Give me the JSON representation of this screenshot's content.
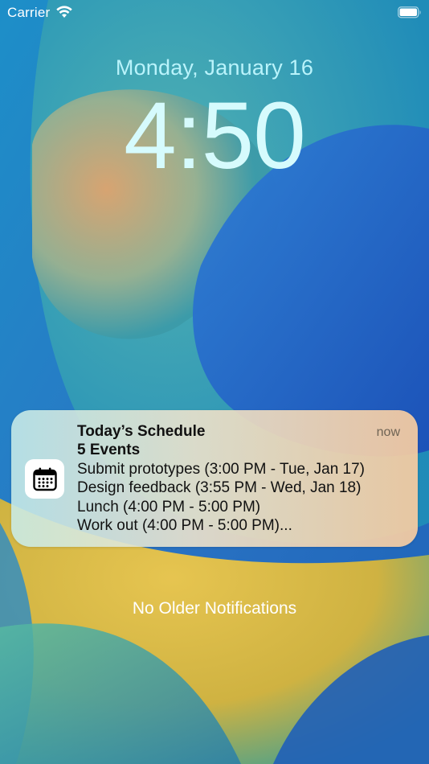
{
  "status_bar": {
    "carrier": "Carrier",
    "wifi_icon": "wifi-icon",
    "battery_icon": "battery-icon"
  },
  "lock_screen": {
    "date": "Monday, January 16",
    "time": "4:50"
  },
  "notification": {
    "app_icon": "calendar-icon",
    "title": "Today’s Schedule",
    "timestamp": "now",
    "subtitle": "5 Events",
    "lines": [
      "Submit prototypes (3:00 PM - Tue, Jan 17)",
      "Design feedback (3:55 PM - Wed, Jan 18)",
      "Lunch (4:00 PM - 5:00 PM)",
      "Work out (4:00 PM - 5:00 PM)..."
    ]
  },
  "footer": {
    "no_older_label": "No Older Notifications"
  }
}
